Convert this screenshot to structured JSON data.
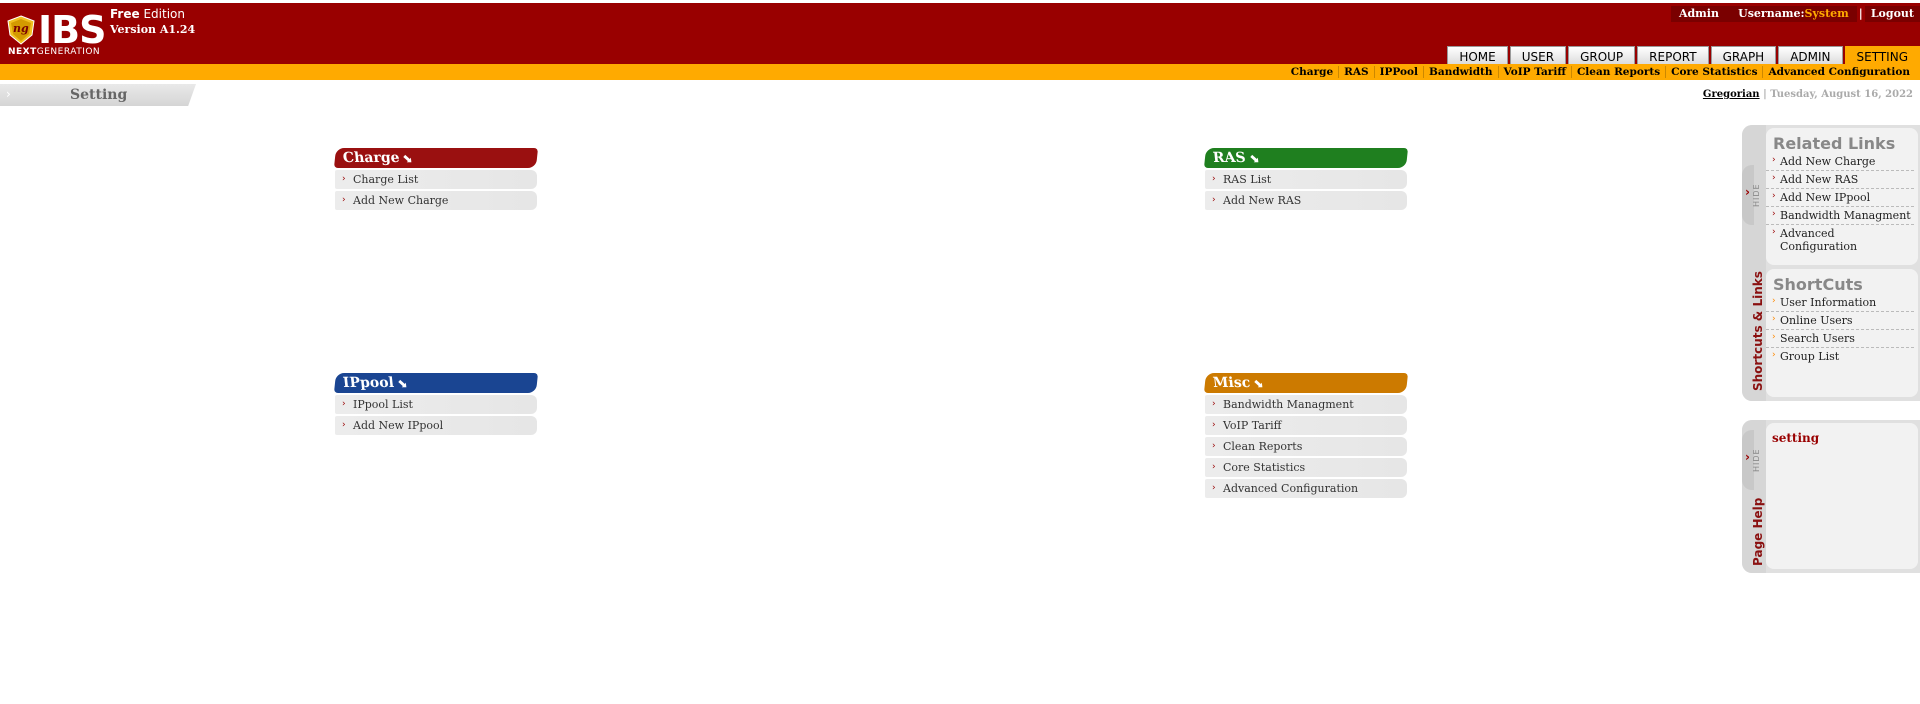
{
  "app": {
    "logo_letters": "IBS",
    "logo_badge": "ng",
    "nextgen_bold": "NEXT",
    "nextgen_rest": "GENERATION",
    "edition_bold": "Free",
    "edition_rest": "Edition",
    "version": "Version A1.24"
  },
  "userbar": {
    "admin": "Admin",
    "username_label": "Username:",
    "username": "System",
    "separator": "|",
    "logout": "Logout"
  },
  "tabs": [
    "HOME",
    "USER",
    "GROUP",
    "REPORT",
    "GRAPH",
    "ADMIN",
    "SETTING"
  ],
  "active_tab": "SETTING",
  "submenu": [
    "Charge",
    "RAS",
    "IPPool",
    "Bandwidth",
    "VoIP Tariff",
    "Clean Reports",
    "Core Statistics",
    "Advanced Configuration"
  ],
  "breadcrumb": {
    "title": "Setting",
    "arrow": "›"
  },
  "date": {
    "calendar": "Gregorian",
    "separator": "|",
    "text": "Tuesday, August 16, 2022"
  },
  "boxes": {
    "charge": {
      "title": "Charge",
      "arrow": "⬊",
      "color": "#9a1010",
      "items": [
        "Charge List",
        "Add New Charge"
      ]
    },
    "ras": {
      "title": "RAS",
      "arrow": "⬊",
      "color": "#1f7f1f",
      "items": [
        "RAS List",
        "Add New RAS"
      ]
    },
    "ippool": {
      "title": "IPpool",
      "arrow": "⬊",
      "color": "#1a4592",
      "items": [
        "IPpool List",
        "Add New IPpool"
      ]
    },
    "misc": {
      "title": "Misc",
      "arrow": "⬊",
      "color": "#cc7a00",
      "items": [
        "Bandwidth Managment",
        "VoIP Tariff",
        "Clean Reports",
        "Core Statistics",
        "Advanced Configuration"
      ]
    }
  },
  "sidepanel": {
    "hide_label": "HIDE",
    "vertical_label": "Shortcuts & Links",
    "related_title": "Related Links",
    "related": [
      "Add New Charge",
      "Add New RAS",
      "Add New IPpool",
      "Bandwidth Managment",
      "Advanced Configuration"
    ],
    "shortcuts_title": "ShortCuts",
    "shortcuts": [
      "User Information",
      "Online Users",
      "Search Users",
      "Group List"
    ]
  },
  "helppanel": {
    "hide_label": "HIDE",
    "vertical_label": "Page Help",
    "text": "setting"
  },
  "colors": {
    "header": "#990000",
    "accent": "#ffaa00"
  }
}
